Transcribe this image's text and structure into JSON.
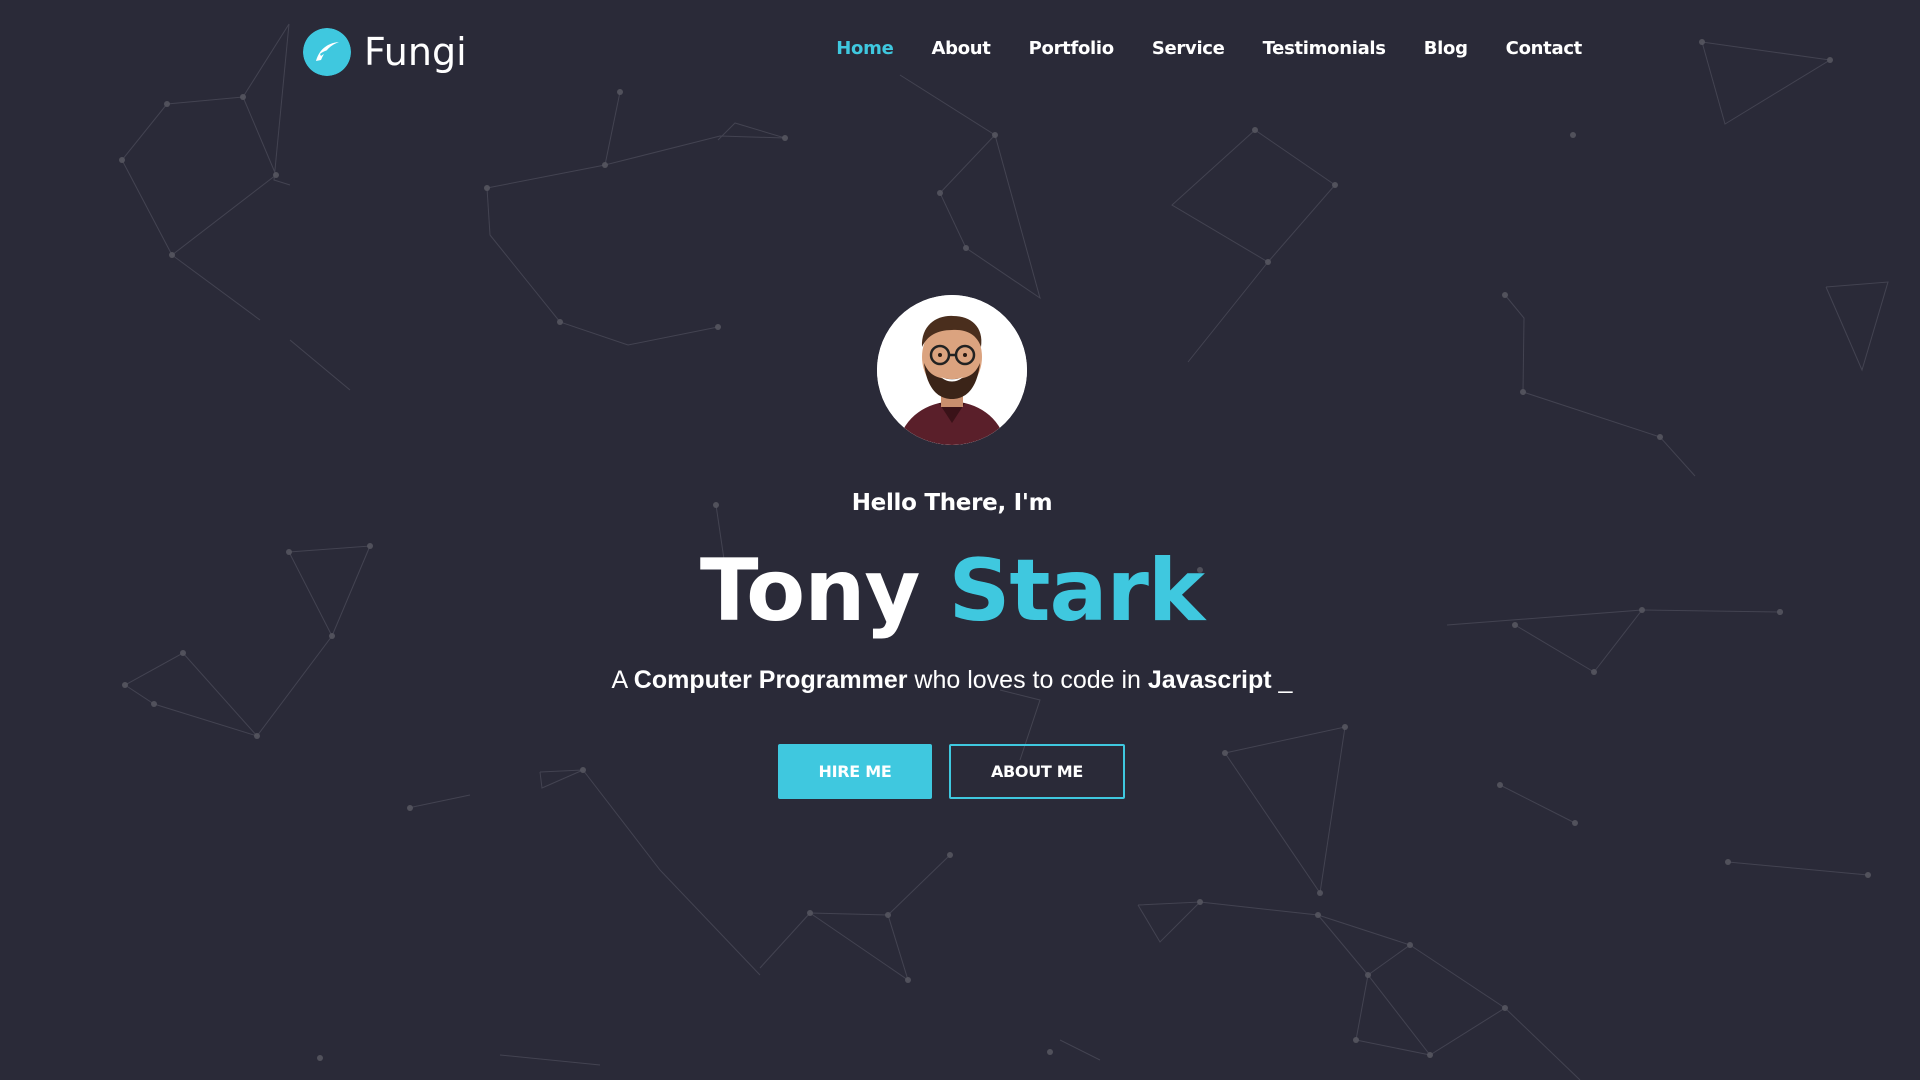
{
  "header": {
    "logo_text": "Fungi",
    "nav": [
      {
        "label": "Home",
        "active": true
      },
      {
        "label": "About",
        "active": false
      },
      {
        "label": "Portfolio",
        "active": false
      },
      {
        "label": "Service",
        "active": false
      },
      {
        "label": "Testimonials",
        "active": false
      },
      {
        "label": "Blog",
        "active": false
      },
      {
        "label": "Contact",
        "active": false
      }
    ]
  },
  "hero": {
    "greeting": "Hello There, I'm",
    "first_name": "Tony",
    "last_name": "Stark",
    "tagline": {
      "prefix": "A",
      "role": "Computer Programmer",
      "middle": "who loves to code in",
      "language": "Javascript",
      "cursor": "_"
    },
    "buttons": {
      "hire": "HIRE ME",
      "about": "ABOUT ME"
    }
  },
  "colors": {
    "background": "#2a2a38",
    "accent": "#3fc8df",
    "text": "#ffffff"
  },
  "icons": {
    "logo": "swoosh-logo-icon",
    "avatar": "profile-photo"
  }
}
